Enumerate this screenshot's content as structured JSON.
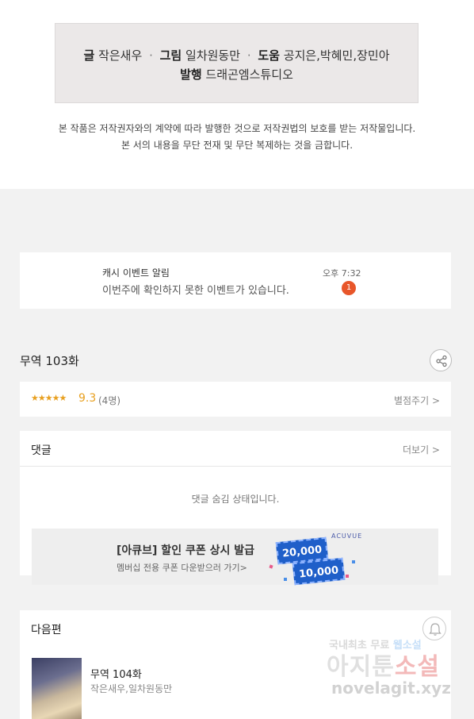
{
  "credits": {
    "writer_label": "글",
    "writer": "작은새우",
    "art_label": "그림",
    "art": "일차원동만",
    "assist_label": "도움",
    "assist": "공지은,박혜민,장민아",
    "publisher_label": "발행",
    "publisher": "드래곤엠스튜디오",
    "separator": "·"
  },
  "copyright_notice": {
    "line1": "본 작품은 저작권자와의 계약에 따라 발행한 것으로 저작권법의 보호를 받는 저작물입니다.",
    "line2": "본 서의 내용을 무단 전재 및 무단 복제하는 것을 금합니다."
  },
  "alert": {
    "title": "캐시 이벤트 알림",
    "message": "이번주에 확인하지 못한 이벤트가 있습니다.",
    "time": "오후 7:32",
    "badge_count": "1"
  },
  "episode": {
    "title": "무역 103화",
    "share_icon": "share-icon"
  },
  "rating": {
    "stars": "★★★★★",
    "score": "9.3",
    "count": "(4명)",
    "rate_link": "별점주기 >"
  },
  "comments": {
    "label": "댓글",
    "more": "더보기 >",
    "hidden_message": "댓글 숨김 상태입니다."
  },
  "ad": {
    "title": "[아큐브] 할인 쿠폰 상시 발급",
    "subtitle": "멤버십 전용 쿠폰 다운받으러 가기>",
    "brand": "ACUVUE",
    "coupon1": "20,000",
    "coupon2": "10,000"
  },
  "next": {
    "label": "다음편",
    "bell_icon": "bell-icon",
    "title": "무역 104화",
    "author": "작은새우,일차원동만"
  },
  "watermark": {
    "line1a": "국내최초 무료",
    "line1b": "웹소설",
    "line2a": "아지툰",
    "line2b": "소설",
    "line3": "novelagit.xyz"
  },
  "colors": {
    "accent_star": "#e8a020",
    "badge": "#e8562a",
    "coupon_blue": "#1f5fc9"
  }
}
